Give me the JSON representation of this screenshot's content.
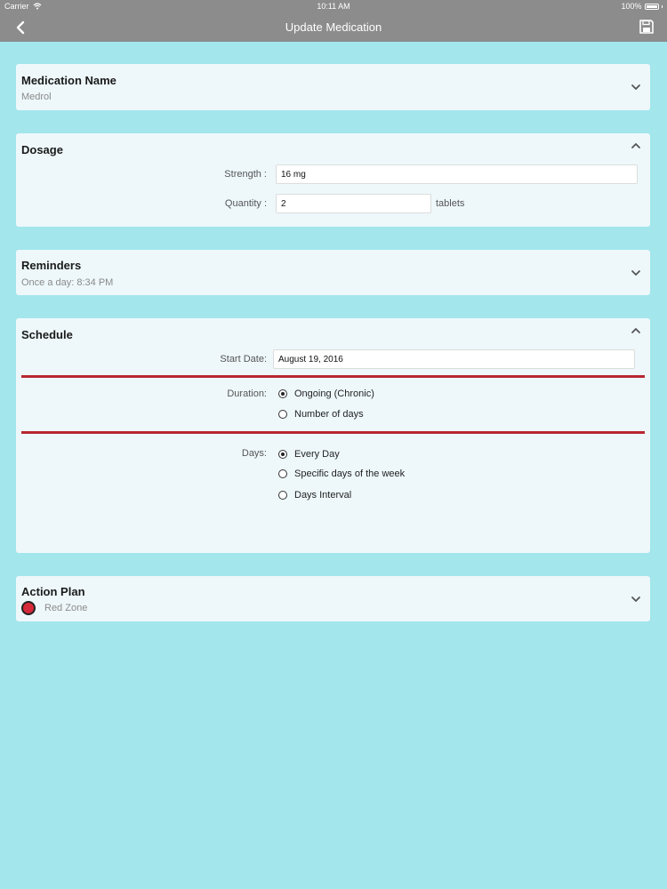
{
  "status_bar": {
    "carrier": "Carrier",
    "time": "10:11 AM",
    "battery": "100%"
  },
  "nav": {
    "title": "Update Medication",
    "back_icon": "chevron-left-icon",
    "save_icon": "floppy-disk-icon"
  },
  "medication": {
    "title": "Medication Name",
    "value": "Medrol"
  },
  "dosage": {
    "title": "Dosage",
    "strength_label": "Strength :",
    "strength_value": "16 mg",
    "quantity_label": "Quantity :",
    "quantity_value": "2",
    "quantity_unit": "tablets"
  },
  "reminders": {
    "title": "Reminders",
    "summary": "Once a day: 8:34 PM"
  },
  "schedule": {
    "title": "Schedule",
    "start_label": "Start Date:",
    "start_value": "August 19, 2016",
    "duration_label": "Duration:",
    "duration_options": [
      "Ongoing (Chronic)",
      "Number of days"
    ],
    "duration_selected": "Ongoing (Chronic)",
    "days_label": "Days:",
    "days_options": [
      "Every Day",
      "Specific days of the week",
      "Days Interval"
    ],
    "days_selected": "Every Day"
  },
  "action_plan": {
    "title": "Action Plan",
    "zone": "Red Zone",
    "zone_color": "#d62a3a"
  },
  "colors": {
    "background": "#a3e6ec",
    "bar": "#8c8c8c",
    "card": "#eef8fb",
    "divider": "#b8272f"
  }
}
